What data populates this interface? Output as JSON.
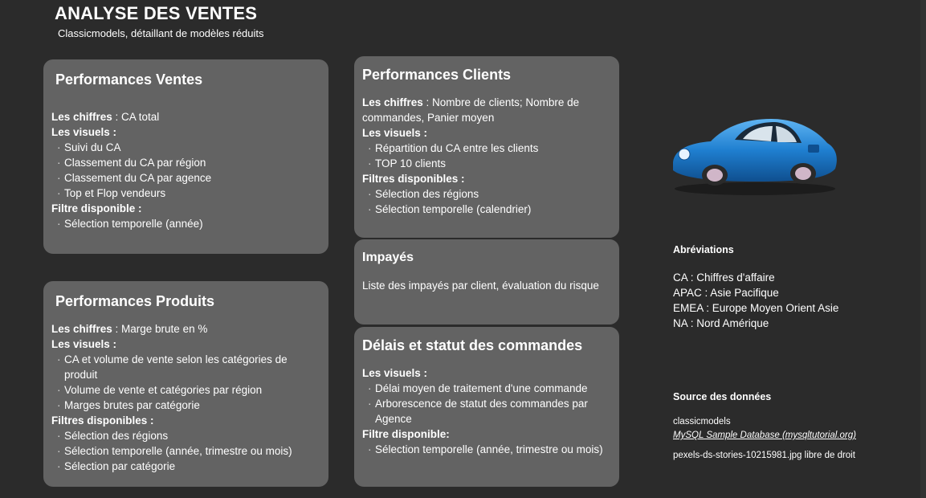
{
  "header": {
    "title": "ANALYSE DES VENTES",
    "subtitle": "Classicmodels, détaillant de modèles réduits"
  },
  "cards": {
    "ventes": {
      "title": "Performances Ventes",
      "chiffres_label": "Les chiffres",
      "chiffres_value": " : CA total",
      "visuels_label": "Les visuels :",
      "visuels": [
        "Suivi du CA",
        "Classement du CA par région",
        "Classement du CA par agence",
        "Top et Flop vendeurs"
      ],
      "filtre_label": "Filtre disponible :",
      "filtres": [
        "Sélection temporelle (année)"
      ]
    },
    "produits": {
      "title": "Performances Produits",
      "chiffres_label": "Les chiffres",
      "chiffres_value": " : Marge brute en %",
      "visuels_label": "Les visuels :",
      "visuels": [
        " CA et volume de vente selon les catégories de produit",
        "Volume de vente et catégories par région",
        "Marges brutes par catégorie"
      ],
      "filtre_label": "Filtres disponibles :",
      "filtres": [
        "Sélection  des régions",
        "Sélection  temporelle (année, trimestre ou mois)",
        "Sélection par catégorie"
      ]
    },
    "clients": {
      "title": "Performances Clients",
      "chiffres_label": "Les chiffres",
      "chiffres_value": " : Nombre de clients; Nombre de commandes, Panier moyen",
      "visuels_label": "Les visuels :",
      "visuels": [
        "Répartition du CA entre les clients",
        "TOP 10 clients"
      ],
      "filtre_label": "Filtres disponibles :",
      "filtres": [
        "Sélection des régions",
        "Sélection temporelle (calendrier)"
      ]
    },
    "impayes": {
      "title": "Impayés",
      "text": "Liste des impayés par client, évaluation du risque"
    },
    "delais": {
      "title": "Délais et statut des commandes",
      "visuels_label": "Les visuels :",
      "visuels": [
        "Délai moyen de traitement d'une commande",
        "Arborescence de statut des commandes par Agence"
      ],
      "filtre_label": "Filtre disponible:",
      "filtres": [
        "Sélection  temporelle (année, trimestre ou mois)"
      ]
    }
  },
  "abbreviations": {
    "title": "Abréviations",
    "items": [
      "CA : Chiffres d'affaire",
      "APAC : Asie Pacifique",
      "EMEA : Europe Moyen Orient Asie",
      "NA : Nord Amérique"
    ]
  },
  "source": {
    "title": "Source des données",
    "name": "classicmodels",
    "link": "MySQL Sample Database (mysqltutorial.org)",
    "image_credit": "pexels-ds-stories-10215981.jpg libre de droit"
  },
  "image": {
    "icon": "classic-car-illustration",
    "car_color": "#1f7fd0"
  }
}
